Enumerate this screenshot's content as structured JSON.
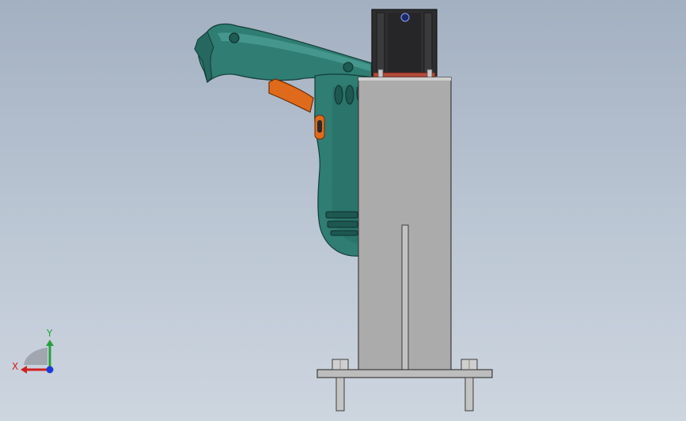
{
  "viewport": {
    "background_top": "#a3b0c1",
    "background_bottom": "#cdd5df"
  },
  "model": {
    "components": [
      {
        "name": "drill-body",
        "color": "#2f7d73"
      },
      {
        "name": "drill-trigger",
        "color": "#e06a1c"
      },
      {
        "name": "stepper-motor",
        "color": "#2e2e30"
      },
      {
        "name": "mounting-column",
        "color": "#ababab"
      },
      {
        "name": "base-plate",
        "color": "#bdbdbd"
      }
    ]
  },
  "triad": {
    "x_label": "X",
    "y_label": "Y",
    "x_color": "#d11f1f",
    "y_color": "#23a23a",
    "z_color": "#1c3ad6"
  }
}
